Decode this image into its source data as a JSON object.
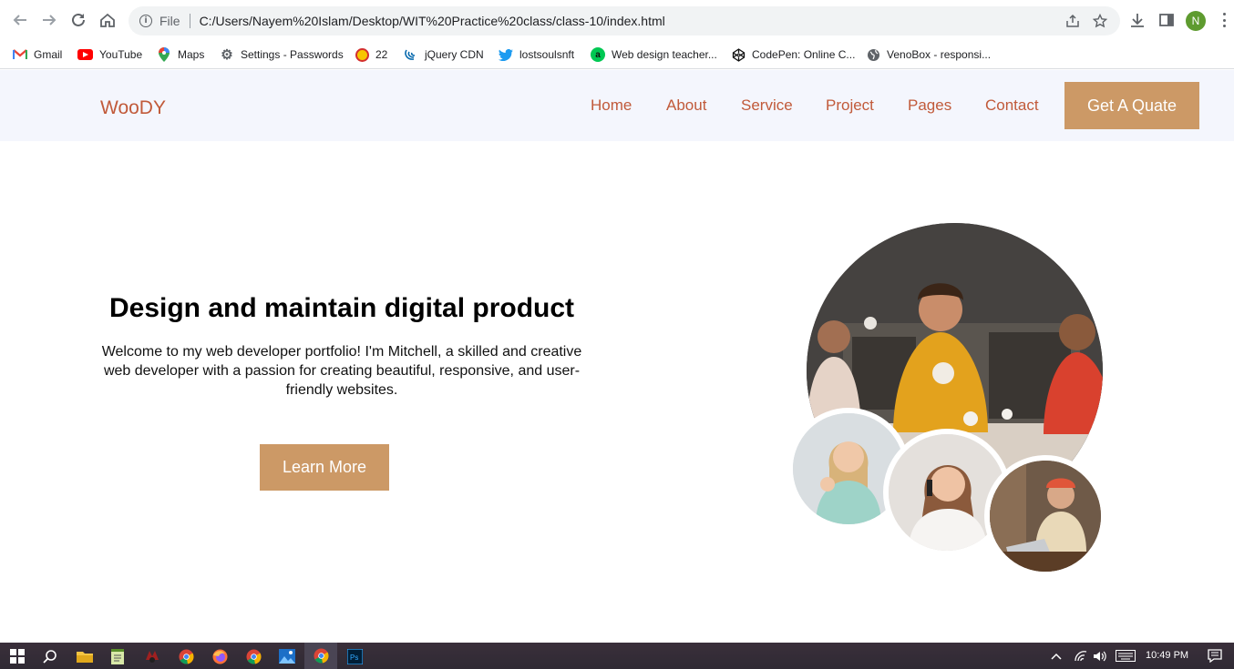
{
  "browser": {
    "omnibox": {
      "scheme_label": "File",
      "url": "C:/Users/Nayem%20Islam/Desktop/WIT%20Practice%20class/class-10/index.html"
    },
    "profile_initial": "N"
  },
  "bookmarks": [
    {
      "label": "Gmail",
      "icon": "gmail-icon"
    },
    {
      "label": "YouTube",
      "icon": "youtube-icon"
    },
    {
      "label": "Maps",
      "icon": "maps-icon"
    },
    {
      "label": "Settings - Passwords",
      "icon": "gear-icon"
    },
    {
      "label": "22",
      "icon": "bangladesh-seal-icon"
    },
    {
      "label": "jQuery CDN",
      "icon": "jquery-icon"
    },
    {
      "label": "lostsoulsnft",
      "icon": "twitter-icon"
    },
    {
      "label": "Web design teacher...",
      "icon": "alibaba-icon"
    },
    {
      "label": "CodePen: Online C...",
      "icon": "codepen-icon"
    },
    {
      "label": "VenoBox - responsi...",
      "icon": "globe-icon"
    }
  ],
  "site": {
    "logo": "WooDY",
    "nav": [
      "Home",
      "About",
      "Service",
      "Project",
      "Pages",
      "Contact"
    ],
    "cta": "Get A Quate",
    "hero": {
      "title": "Design and maintain digital product",
      "text": "Welcome to my web developer portfolio! I'm Mitchell, a skilled and creative web developer with a passion for creating beautiful, responsive, and user-friendly websites.",
      "button": "Learn More"
    },
    "colors": {
      "accent": "#cc9966",
      "link": "#c15a3a",
      "header_bg": "#f4f6fd"
    }
  },
  "taskbar": {
    "apps": [
      "windows-start-icon",
      "search-icon",
      "file-explorer-icon",
      "notepad-icon",
      "game-icon",
      "chrome-icon",
      "firefox-icon",
      "chrome-icon",
      "photos-icon",
      "chrome-icon",
      "photoshop-icon"
    ],
    "clock": "10:49 PM"
  }
}
